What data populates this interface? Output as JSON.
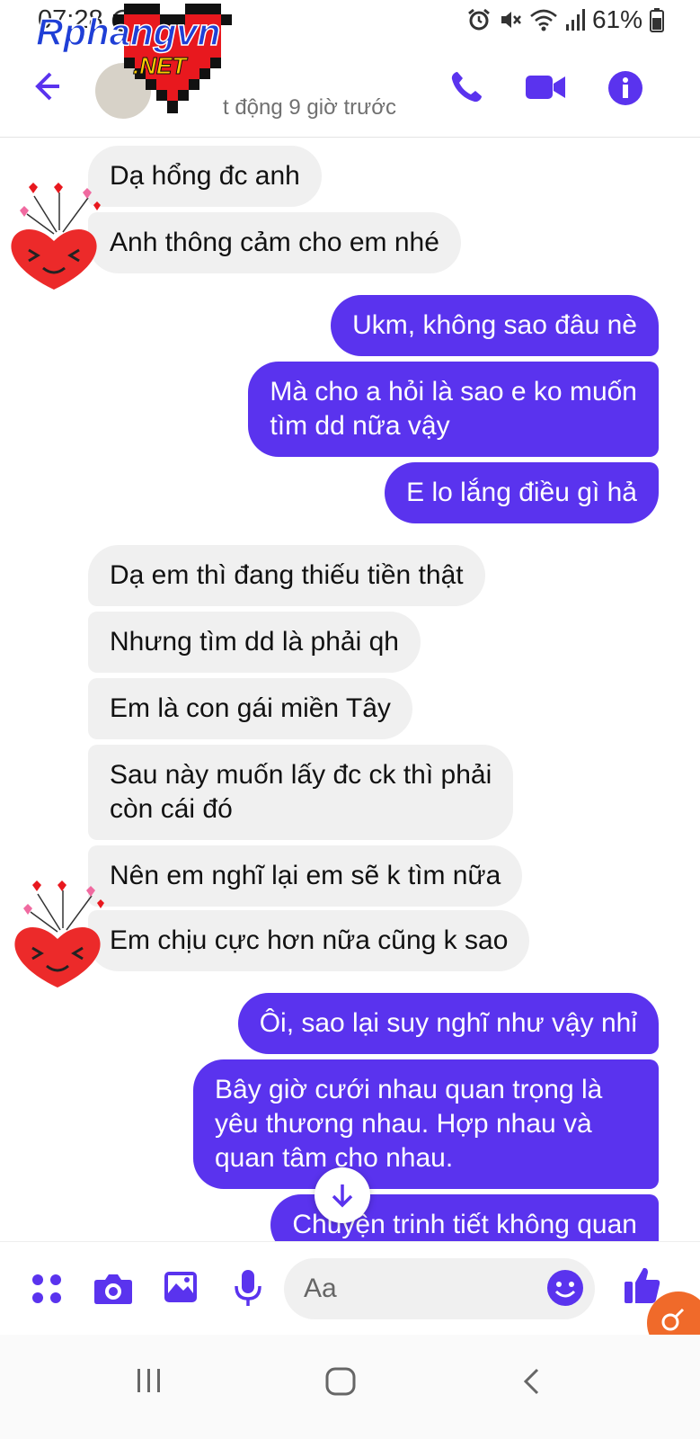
{
  "status_bar": {
    "time": "07:28",
    "battery": "61%",
    "icons": [
      "messenger-icon",
      "alarm-icon",
      "mute-icon",
      "wifi-icon",
      "signal-icon",
      "battery-icon"
    ]
  },
  "header": {
    "active_status": "t động 9 giờ trước",
    "logo_text_top": "Rphangvn",
    "logo_text_bottom": ".NET",
    "icons": [
      "back-arrow-icon",
      "phone-icon",
      "video-camera-icon",
      "info-icon"
    ],
    "accent_color": "#5a33ee"
  },
  "messages": [
    {
      "side": "received",
      "text": "Dạ hổng đc anh"
    },
    {
      "side": "received",
      "text": "Anh thông cảm cho em nhé"
    },
    {
      "side": "sent",
      "text": "Ukm, không sao đâu nè"
    },
    {
      "side": "sent",
      "text": "Mà cho a hỏi là sao e ko muốn\ntìm dd nữa vậy"
    },
    {
      "side": "sent",
      "text": "E lo lắng điều gì hả"
    },
    {
      "side": "received",
      "text": "Dạ em thì đang thiếu tiền thật"
    },
    {
      "side": "received",
      "text": "Nhưng tìm dd là phải qh"
    },
    {
      "side": "received",
      "text": "Em là con gái miền Tây"
    },
    {
      "side": "received",
      "text": "Sau này muốn lấy đc ck thì phải\ncòn cái đó"
    },
    {
      "side": "received",
      "text": "Nên em nghĩ lại em sẽ k tìm nữa"
    },
    {
      "side": "received",
      "text": "Em chịu cực hơn nữa cũng k sao"
    },
    {
      "side": "sent",
      "text": "Ôi, sao lại suy nghĩ như vậy nhỉ"
    },
    {
      "side": "sent",
      "text": "Bây giờ cưới nhau quan trọng là\nyêu thương nhau. Hợp nhau và\nquan tâm cho nhau."
    },
    {
      "side": "sent",
      "text": "Chuyện trinh tiết không quan"
    }
  ],
  "composer": {
    "placeholder": "Aa",
    "icons": [
      "menu-dots-icon",
      "camera-icon",
      "image-icon",
      "microphone-icon",
      "emoji-icon",
      "thumbs-up-icon"
    ]
  },
  "nav_bar": {
    "icons": [
      "recent-apps-icon",
      "home-icon",
      "back-icon"
    ]
  }
}
